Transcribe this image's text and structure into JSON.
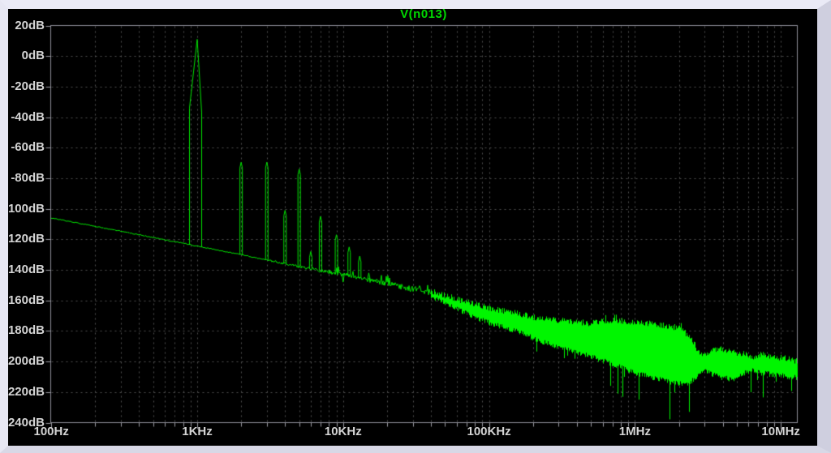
{
  "window": {
    "title_bar_text": "V(n013)"
  },
  "colors": {
    "panel_background": "#000000",
    "border_top": "#eaeaf6",
    "border_left": "#e7e7f3",
    "border_right": "#cfcfdf",
    "border_bottom": "#d8d8e6",
    "frame": "#8e8e98",
    "grid": "#525252",
    "tick": "#9a9aa2",
    "axis_label": "#d4d4d4",
    "title": "#00d900",
    "trace": "#00e600",
    "trace_bright": "#00f600"
  },
  "chart_data": {
    "type": "line",
    "title": "V(n013)",
    "trace_name": "V(n013)",
    "legend_position": "top-center",
    "grid": true,
    "x_axis": {
      "scale": "log",
      "unit": "Hz",
      "min": 100,
      "max": 13100000,
      "ticks": [
        {
          "value": 100,
          "label": "100Hz"
        },
        {
          "value": 1000,
          "label": "1KHz"
        },
        {
          "value": 10000,
          "label": "10KHz"
        },
        {
          "value": 100000,
          "label": "100KHz"
        },
        {
          "value": 1000000,
          "label": "1MHz"
        },
        {
          "value": 10000000,
          "label": "10MHz"
        }
      ]
    },
    "y_axis": {
      "unit": "dB",
      "min": -240,
      "max": 20,
      "step": 20,
      "ticks": [
        {
          "value": 20,
          "label": "20dB"
        },
        {
          "value": 0,
          "label": "0dB"
        },
        {
          "value": -20,
          "label": "-20dB"
        },
        {
          "value": -40,
          "label": "-40dB"
        },
        {
          "value": -60,
          "label": "-60dB"
        },
        {
          "value": -80,
          "label": "-80dB"
        },
        {
          "value": -100,
          "label": "-100dB"
        },
        {
          "value": -120,
          "label": "-120dB"
        },
        {
          "value": -140,
          "label": "-140dB"
        },
        {
          "value": -160,
          "label": "-160dB"
        },
        {
          "value": -180,
          "label": "-180dB"
        },
        {
          "value": -200,
          "label": "-200dB"
        },
        {
          "value": -220,
          "label": "-220dB"
        },
        {
          "value": -240,
          "label": "-240dB"
        }
      ]
    },
    "noise_floor_db": [
      [
        100,
        -106
      ],
      [
        200,
        -111.5
      ],
      [
        400,
        -117
      ],
      [
        700,
        -121.5
      ],
      [
        1000,
        -124.5
      ],
      [
        2000,
        -130
      ],
      [
        4000,
        -136
      ],
      [
        7000,
        -140.5
      ],
      [
        10000,
        -143
      ],
      [
        20000,
        -149
      ],
      [
        40000,
        -155
      ]
    ],
    "harmonic_peaks_db": [
      [
        1000,
        11
      ],
      [
        2000,
        -69.5
      ],
      [
        3000,
        -69.5
      ],
      [
        4000,
        -101
      ],
      [
        5000,
        -74
      ],
      [
        6000,
        -128
      ],
      [
        7000,
        -105
      ],
      [
        8000,
        -140
      ],
      [
        9000,
        -117
      ],
      [
        10000,
        -148
      ],
      [
        11000,
        -125
      ],
      [
        13000,
        -131
      ],
      [
        15000,
        -142
      ],
      [
        17000,
        -146
      ],
      [
        19000,
        -150
      ]
    ],
    "fundamental": {
      "freq": 1000,
      "peak_db": 11,
      "shoulder_db": -35
    },
    "noise_band_db": [
      [
        40000,
        -154,
        -156
      ],
      [
        70000,
        -161,
        -167
      ],
      [
        100000,
        -165,
        -173
      ],
      [
        150000,
        -168,
        -178
      ],
      [
        200000,
        -171,
        -183
      ],
      [
        300000,
        -173,
        -189
      ],
      [
        500000,
        -175,
        -195
      ],
      [
        700000,
        -173,
        -200
      ],
      [
        1000000,
        -174,
        -206
      ],
      [
        1500000,
        -176,
        -210
      ],
      [
        2000000,
        -178,
        -213
      ],
      [
        2400000,
        -184,
        -212
      ],
      [
        2700000,
        -193,
        -207
      ],
      [
        3000000,
        -196,
        -204
      ],
      [
        3400000,
        -192,
        -207
      ],
      [
        4000000,
        -192,
        -209
      ],
      [
        4700000,
        -194,
        -210
      ],
      [
        5500000,
        -195,
        -206
      ],
      [
        6300000,
        -197,
        -204
      ],
      [
        7500000,
        -195,
        -206
      ],
      [
        9000000,
        -197,
        -207
      ],
      [
        11000000,
        -198,
        -208
      ],
      [
        13100000,
        -200,
        -209
      ]
    ],
    "noise_spike_floor_db": -238
  }
}
